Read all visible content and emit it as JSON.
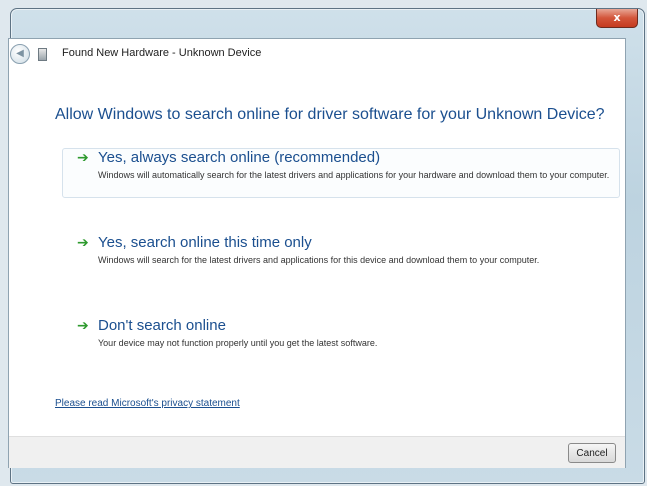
{
  "window": {
    "close_glyph": "x"
  },
  "nav": {
    "back_glyph": "◀",
    "title": "Found New Hardware - Unknown Device"
  },
  "main": {
    "instruction": "Allow Windows to search online for driver software for your Unknown Device?",
    "options": [
      {
        "title": "Yes, always search online (recommended)",
        "description": "Windows will automatically search for the latest drivers and applications for your hardware and download them to your computer."
      },
      {
        "title": "Yes, search online this time only",
        "description": "Windows will search for the latest drivers and applications for this device and download them to your computer."
      },
      {
        "title": "Don't search online",
        "description": "Your device may not function properly until you get the latest software."
      }
    ],
    "privacy_link": "Please read Microsoft's privacy statement"
  },
  "footer": {
    "cancel_label": "Cancel"
  },
  "colors": {
    "accent_text": "#1b4f8f",
    "arrow_green": "#2e9a2e"
  }
}
